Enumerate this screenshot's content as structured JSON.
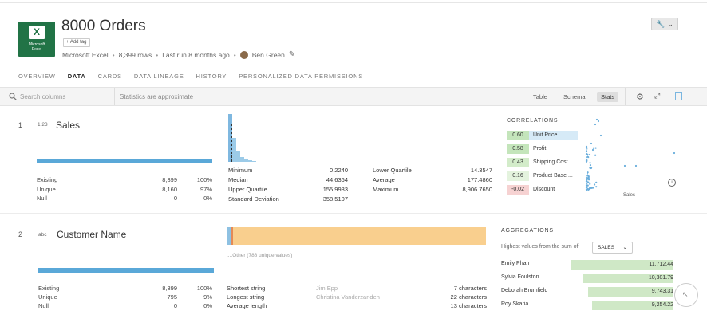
{
  "header": {
    "logo_line1": "Microsoft",
    "logo_line2": "Excel",
    "logo_glyph": "X",
    "title": "8000 Orders",
    "add_tag": "+ Add tag",
    "source": "Microsoft Excel",
    "rows": "8,399 rows",
    "last_run": "Last run 8 months ago",
    "owner": "Ben Green"
  },
  "tabs": [
    "OVERVIEW",
    "DATA",
    "CARDS",
    "DATA LINEAGE",
    "HISTORY",
    "PERSONALIZED DATA PERMISSIONS"
  ],
  "active_tab": "DATA",
  "toolbar": {
    "search_placeholder": "Search columns",
    "approx_note": "Statistics are approximate",
    "views": [
      "Table",
      "Schema",
      "Stats"
    ],
    "active_view": "Stats"
  },
  "sales": {
    "index": "1",
    "type": "1.23",
    "name": "Sales",
    "completeness_fraction": 1.0,
    "existing_label": "Existing",
    "existing_value": "8,399",
    "existing_pct": "100%",
    "unique_label": "Unique",
    "unique_value": "8,160",
    "unique_pct": "97%",
    "null_label": "Null",
    "null_value": "0",
    "null_pct": "0%",
    "stats_left": [
      {
        "k": "Minimum",
        "v": "0.2240"
      },
      {
        "k": "Median",
        "v": "44.6364"
      },
      {
        "k": "Upper Quartile",
        "v": "155.9983"
      },
      {
        "k": "Standard Deviation",
        "v": "358.5107"
      }
    ],
    "stats_right": [
      {
        "k": "Lower Quartile",
        "v": "14.3547"
      },
      {
        "k": "Average",
        "v": "177.4860"
      },
      {
        "k": "Maximum",
        "v": "8,906.7650"
      }
    ],
    "correlations_title": "CORRELATIONS",
    "correlations": [
      {
        "value": "0.60",
        "label": "Unit Price",
        "color": "#c4e5bb",
        "selected": true
      },
      {
        "value": "0.58",
        "label": "Profit",
        "color": "#c4e5bb",
        "selected": false
      },
      {
        "value": "0.43",
        "label": "Shipping Cost",
        "color": "#d3ecca",
        "selected": false
      },
      {
        "value": "0.16",
        "label": "Product Base ...",
        "color": "#e4f3de",
        "selected": false
      },
      {
        "value": "-0.02",
        "label": "Discount",
        "color": "#f6d2d2",
        "selected": false
      }
    ],
    "scatter_xlabel": "Sales"
  },
  "customer": {
    "index": "2",
    "type": "abc",
    "name": "Customer Name",
    "completeness_fraction": 1.0,
    "existing_label": "Existing",
    "existing_value": "8,399",
    "existing_pct": "100%",
    "unique_label": "Unique",
    "unique_value": "795",
    "unique_pct": "9%",
    "null_label": "Null",
    "null_value": "0",
    "null_pct": "0%",
    "other_label": "....Other (788 unique values)",
    "strings": [
      {
        "k": "Shortest string",
        "m": "Jim Epp",
        "v": "7 characters"
      },
      {
        "k": "Longest string",
        "m": "Christina Vanderzanden",
        "v": "22 characters"
      },
      {
        "k": "Average length",
        "m": "",
        "v": "13 characters"
      }
    ],
    "agg_title": "AGGREGATIONS",
    "agg_subtitle": "Highest values from the sum of",
    "agg_select": "SALES",
    "aggregations": [
      {
        "name": "Emily Phan",
        "value": "11,712.44",
        "num": 11712.44
      },
      {
        "name": "Sylvia Foulston",
        "value": "10,301.79",
        "num": 10301.79
      },
      {
        "name": "Deborah Brumfield",
        "value": "9,743.31",
        "num": 9743.31
      },
      {
        "name": "Roy Skaria",
        "value": "9,254.22",
        "num": 9254.22
      }
    ]
  }
}
